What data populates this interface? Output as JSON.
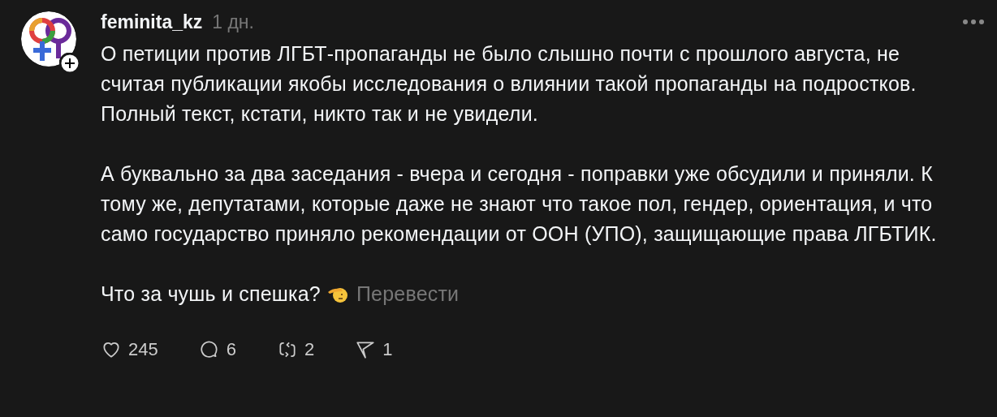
{
  "post": {
    "author": "feminita_kz",
    "time": "1 дн.",
    "paragraphs": [
      "О петиции против ЛГБТ-пропаганды не было слышно почти с прошлого августа, не считая публикации якобы исследования о влиянии такой пропаганды на подростков. Полный текст, кстати, никто так и не увидели.",
      "А буквально за два заседания - вчера и сегодня - поправки уже обсудили и приняли. К тому же, депутатами, которые даже не знают что такое пол, гендер, ориентация, и что само государство приняло рекомендации от ООН (УПО), защищающие права ЛГБТИК.",
      "Что за чушь и спешка?"
    ],
    "translate": "Перевести",
    "actions": [
      {
        "kind": "like",
        "count": "245"
      },
      {
        "kind": "reply",
        "count": "6"
      },
      {
        "kind": "repost",
        "count": "2"
      },
      {
        "kind": "share",
        "count": "1"
      }
    ]
  }
}
